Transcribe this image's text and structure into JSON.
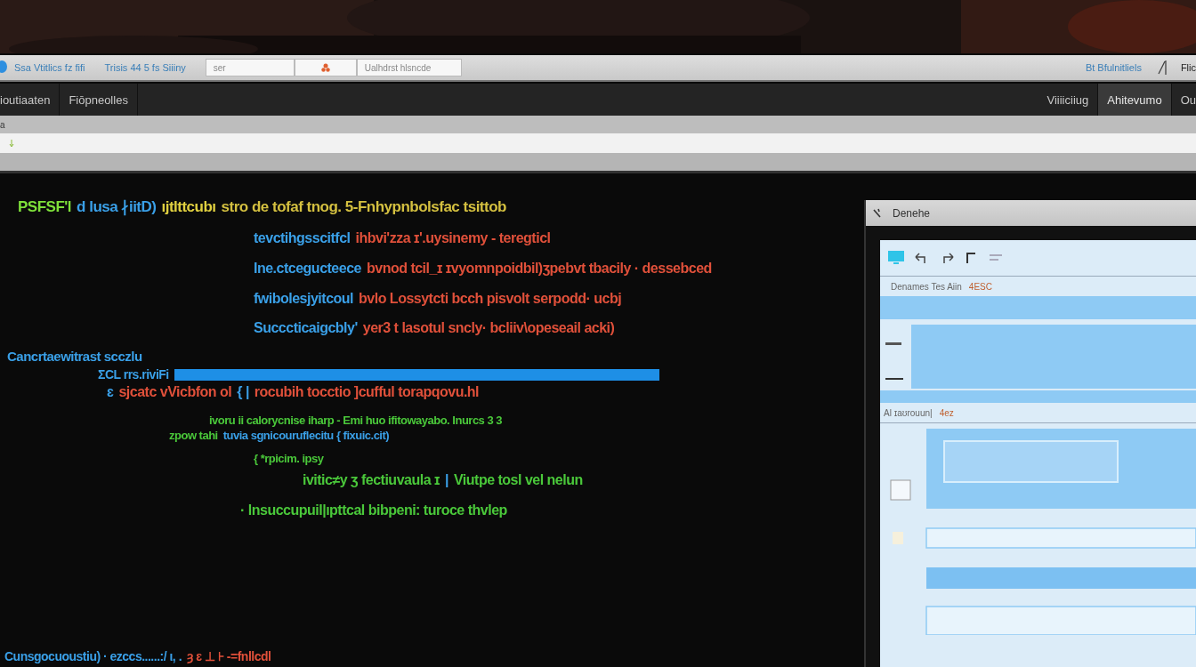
{
  "toolbar": {
    "groups": [
      "Ssa Vtitlics fz fifi",
      "Trisis 44 5 fs Siiiny"
    ],
    "fields": [
      {
        "kind": "text",
        "value": "ser"
      },
      {
        "kind": "icon"
      },
      {
        "kind": "text",
        "value": "Ualhdrst hlsncde"
      }
    ],
    "right": [
      "Bt Bfulnitliels",
      "Flic"
    ]
  },
  "tabs": [
    {
      "label": "ioutiaaten",
      "selected": false
    },
    {
      "label": "Fiōpneolles",
      "selected": false
    }
  ],
  "right_tabs": [
    {
      "label": "Viiiiciiug",
      "selected": false
    },
    {
      "label": "Ahitevumo",
      "selected": true
    },
    {
      "label": "Ou",
      "selected": false
    }
  ],
  "path_bar": {
    "text": "a"
  },
  "editor": {
    "lines": [
      {
        "highlighted": false,
        "segments": [
          {
            "text": "PSFSF'l",
            "color": "#7ee03a"
          },
          {
            "text": "d lusa ∤iitD)",
            "color": "#3aa0e8"
          },
          {
            "text": "ıjtlttcubı",
            "color": "#e0d040"
          },
          {
            "text": "stro de tofaf tnog. 5-Fnhypnbolsfac tsittob",
            "color": "#d4c040"
          }
        ]
      },
      {
        "highlighted": false,
        "segments": [
          {
            "text": "tevctihgsscitfcl",
            "color": "#3aa0e8"
          },
          {
            "text": "ihbvi'zza ɪ'.uysinemy - teregticl",
            "color": "#e0503a"
          }
        ]
      },
      {
        "highlighted": false,
        "segments": [
          {
            "text": "Ine.ctcegucteece",
            "color": "#3aa0e8"
          },
          {
            "text": "bvnod tcil_ɪ ɪvyomnpoidbil)ʒpebvt tbacily · dessebced",
            "color": "#e0503a"
          }
        ]
      },
      {
        "highlighted": false,
        "segments": [
          {
            "text": "fwibolesjyitcoul",
            "color": "#3aa0e8"
          },
          {
            "text": "bvlo Lossytcti bcch pisvolt serpodd· ucbj",
            "color": "#e0503a"
          }
        ]
      },
      {
        "highlighted": false,
        "segments": [
          {
            "text": "Succcticaigcbly'",
            "color": "#3aa0e8"
          },
          {
            "text": "yer3 t lasotul sncly· bcliiv\\opeseail acki)",
            "color": "#e0503a"
          }
        ]
      },
      {
        "highlighted": false,
        "segments": [
          {
            "text": "Cancrtaewitrast scczlu",
            "color": "#3aa0e8"
          }
        ]
      },
      {
        "highlighted": true,
        "segments": [
          {
            "text": "ΣCL rrs.riviFi",
            "color": "#3aa0e8"
          }
        ]
      },
      {
        "highlighted": false,
        "segments": [
          {
            "text": "ɛ",
            "color": "#3aa0e8"
          },
          {
            "text": "sjcatc vVicbfon ol",
            "color": "#e0503a"
          },
          {
            "text": "{ |",
            "color": "#3aa0e8"
          },
          {
            "text": "rocubih tocctio ]cufful torapqovu.hl",
            "color": "#e0503a"
          }
        ]
      },
      {
        "highlighted": false,
        "segments": [
          {
            "text": "ivoru ii calorycnise iharp - Emi huo ifitowayabo. Inurcs 3 3",
            "color": "#4ac83a"
          }
        ]
      },
      {
        "highlighted": false,
        "segments": [
          {
            "text": "zpow tahi",
            "color": "#4ac83a"
          },
          {
            "text": "tuvia sgnicouruflecitu { fixuic.cit)",
            "color": "#3aa0e8"
          }
        ]
      },
      {
        "highlighted": false,
        "segments": [
          {
            "text": "{ *rpicim. ipsy",
            "color": "#4ac83a"
          }
        ]
      },
      {
        "highlighted": false,
        "segments": [
          {
            "text": "ivitic≠y ʒ fectiuvaula ɪ",
            "color": "#4ac83a"
          },
          {
            "text": "|",
            "color": "#3aa0e8"
          },
          {
            "text": "Viutpe tosl vel nelun",
            "color": "#4ac83a"
          }
        ]
      },
      {
        "highlighted": false,
        "segments": [
          {
            "text": "· lnsuccupuil|ıpttcal bibpeni: turoce thvlep",
            "color": "#4ac83a"
          }
        ]
      },
      {
        "highlighted": false,
        "segments": [
          {
            "text": "Cunsgocuoustiu) · ezccs......:/ ι, .",
            "color": "#3aa0e8"
          },
          {
            "text": "ȝ ɛ ⊥ ⊦ -=fnllcdl",
            "color": "#e0503a"
          }
        ]
      }
    ]
  },
  "side_window": {
    "title": "Denehe",
    "label_1": {
      "text": "Denames Tes Aiin",
      "tag": "4ESC"
    },
    "label_2": {
      "text": "Al ɪaʊrouun|",
      "tag": "4ez"
    }
  }
}
